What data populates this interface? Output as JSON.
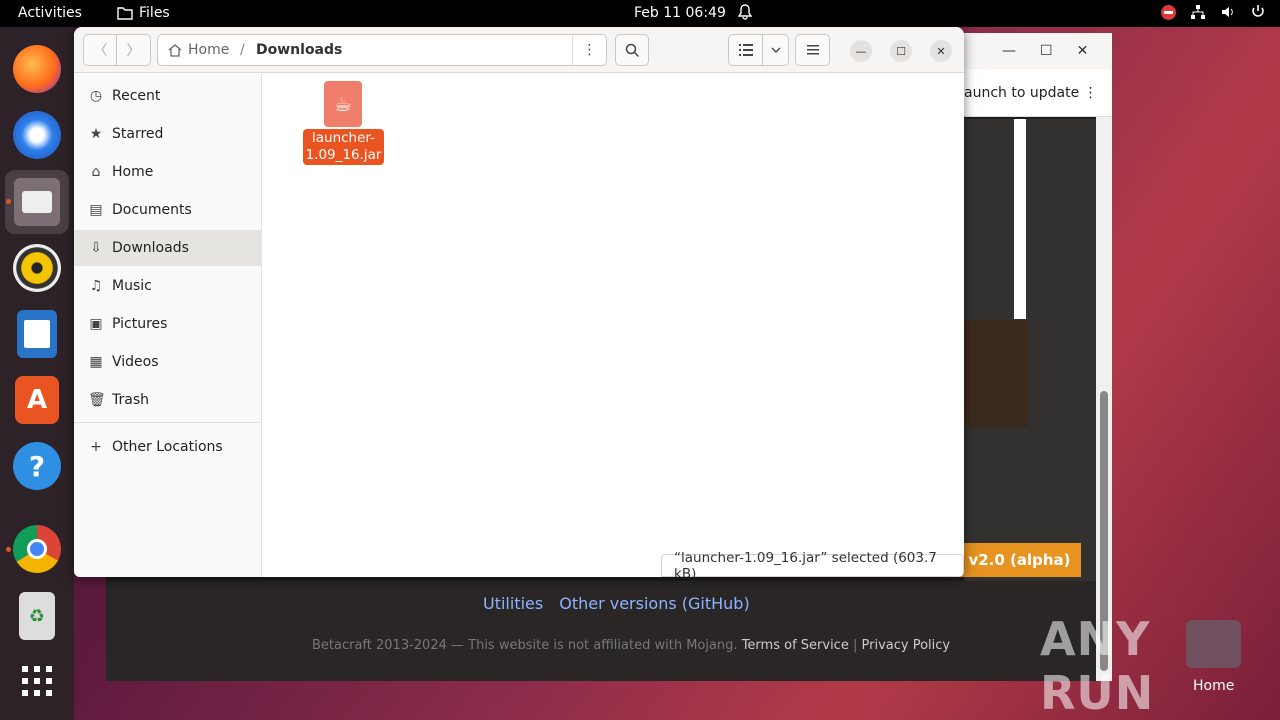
{
  "topbar": {
    "activities": "Activities",
    "app_name": "Files",
    "clock": "Feb 11  06:49"
  },
  "files_window": {
    "path_home": "Home",
    "path_separator": "/",
    "path_current": "Downloads",
    "sidebar": {
      "items": [
        {
          "label": "Recent",
          "icon": "clock-icon"
        },
        {
          "label": "Starred",
          "icon": "star-icon"
        },
        {
          "label": "Home",
          "icon": "home-icon"
        },
        {
          "label": "Documents",
          "icon": "document-icon"
        },
        {
          "label": "Downloads",
          "icon": "download-icon",
          "selected": true
        },
        {
          "label": "Music",
          "icon": "music-icon"
        },
        {
          "label": "Pictures",
          "icon": "picture-icon"
        },
        {
          "label": "Videos",
          "icon": "video-icon"
        },
        {
          "label": "Trash",
          "icon": "trash-icon"
        }
      ],
      "other_locations": "Other Locations"
    },
    "file": {
      "name_line1": "launcher-",
      "name_line2": "1.09_16.jar"
    },
    "status": "“launcher-1.09_16.jar” selected  (603.7 kB)"
  },
  "browser": {
    "update_text": "aunch to update",
    "version_button": "v2.0 (alpha)",
    "links": [
      "Utilities",
      "Other versions (GitHub)"
    ],
    "footer_text": "Betacraft 2013-2024 — This website is not affiliated with Mojang.",
    "terms": "Terms of Service",
    "footer_sep": "|",
    "privacy": "Privacy Policy"
  },
  "desktop": {
    "watermark": "ANY RUN",
    "home_label": "Home"
  },
  "colors": {
    "accent": "#e95420",
    "file_icon": "#ef7f6a",
    "version_button": "#e6931f"
  }
}
